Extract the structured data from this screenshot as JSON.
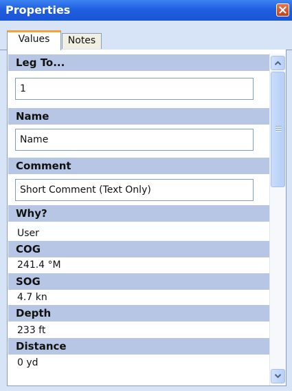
{
  "window": {
    "title": "Properties"
  },
  "tabs": [
    {
      "label": "Values",
      "active": true
    },
    {
      "label": "Notes",
      "active": false
    }
  ],
  "properties": {
    "leg_to": {
      "label": "Leg To...",
      "value": "1"
    },
    "name": {
      "label": "Name",
      "value": "Name"
    },
    "comment": {
      "label": "Comment",
      "value": "Short Comment (Text Only)"
    },
    "why": {
      "label": "Why?",
      "value": "User"
    },
    "cog": {
      "label": "COG",
      "value": "241.4 °M"
    },
    "sog": {
      "label": "SOG",
      "value": "4.7 kn"
    },
    "depth": {
      "label": "Depth",
      "value": "233 ft"
    },
    "distance": {
      "label": "Distance",
      "value": "0 yd"
    }
  },
  "colors": {
    "title_bar": "#1f5fe0",
    "section_header": "#b7c6e4",
    "active_tab_accent": "#f6a23a",
    "close_button": "#c43d1d"
  },
  "icons": {
    "close": "close-icon",
    "scroll_up": "chevron-up-icon",
    "scroll_down": "chevron-down-icon"
  }
}
